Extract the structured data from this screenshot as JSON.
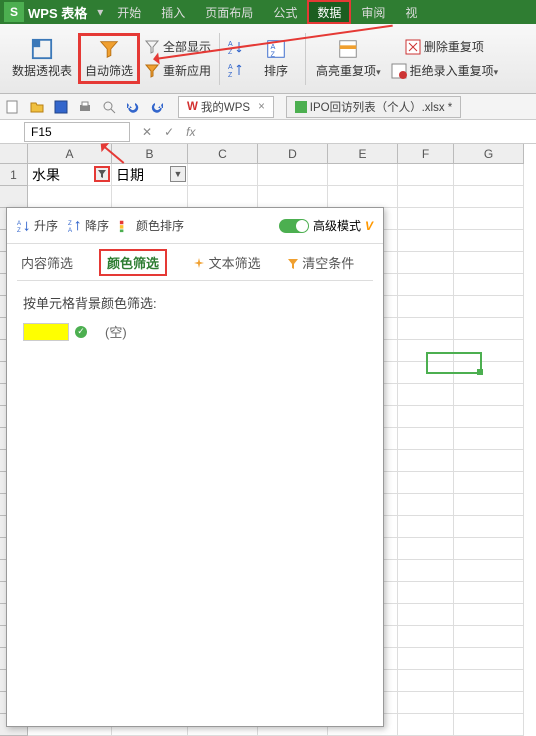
{
  "app": {
    "name": "WPS 表格"
  },
  "menu": {
    "start": "开始",
    "insert": "插入",
    "layout": "页面布局",
    "formula": "公式",
    "data": "数据",
    "review": "审阅",
    "view": "视"
  },
  "ribbon": {
    "pivot": "数据透视表",
    "autofilter": "自动筛选",
    "showall": "全部显示",
    "reapply": "重新应用",
    "sort": "排序",
    "highlight": "高亮重复项",
    "highlight_drop": "▾",
    "deldup": "删除重复项",
    "reject": "拒绝录入重复项",
    "reject_drop": "▾"
  },
  "tabs": {
    "mywps": "我的WPS",
    "file": "IPO回访列表（个人）.xlsx *"
  },
  "namebox": {
    "ref": "F15"
  },
  "fx": {
    "cancel": "✕",
    "ok": "✓",
    "fx": "fx"
  },
  "cols": [
    "A",
    "B",
    "C",
    "D",
    "E",
    "F",
    "G"
  ],
  "row1": {
    "num": "1",
    "A": "水果",
    "B": "日期"
  },
  "panel": {
    "asc": "升序",
    "desc": "降序",
    "colorsort": "颜色排序",
    "adv": "高级模式",
    "tab_content": "内容筛选",
    "tab_color": "颜色筛选",
    "tab_text": "文本筛选",
    "tab_clear": "清空条件",
    "body_label": "按单元格背景颜色筛选:",
    "empty": "(空)"
  },
  "vip": "V"
}
